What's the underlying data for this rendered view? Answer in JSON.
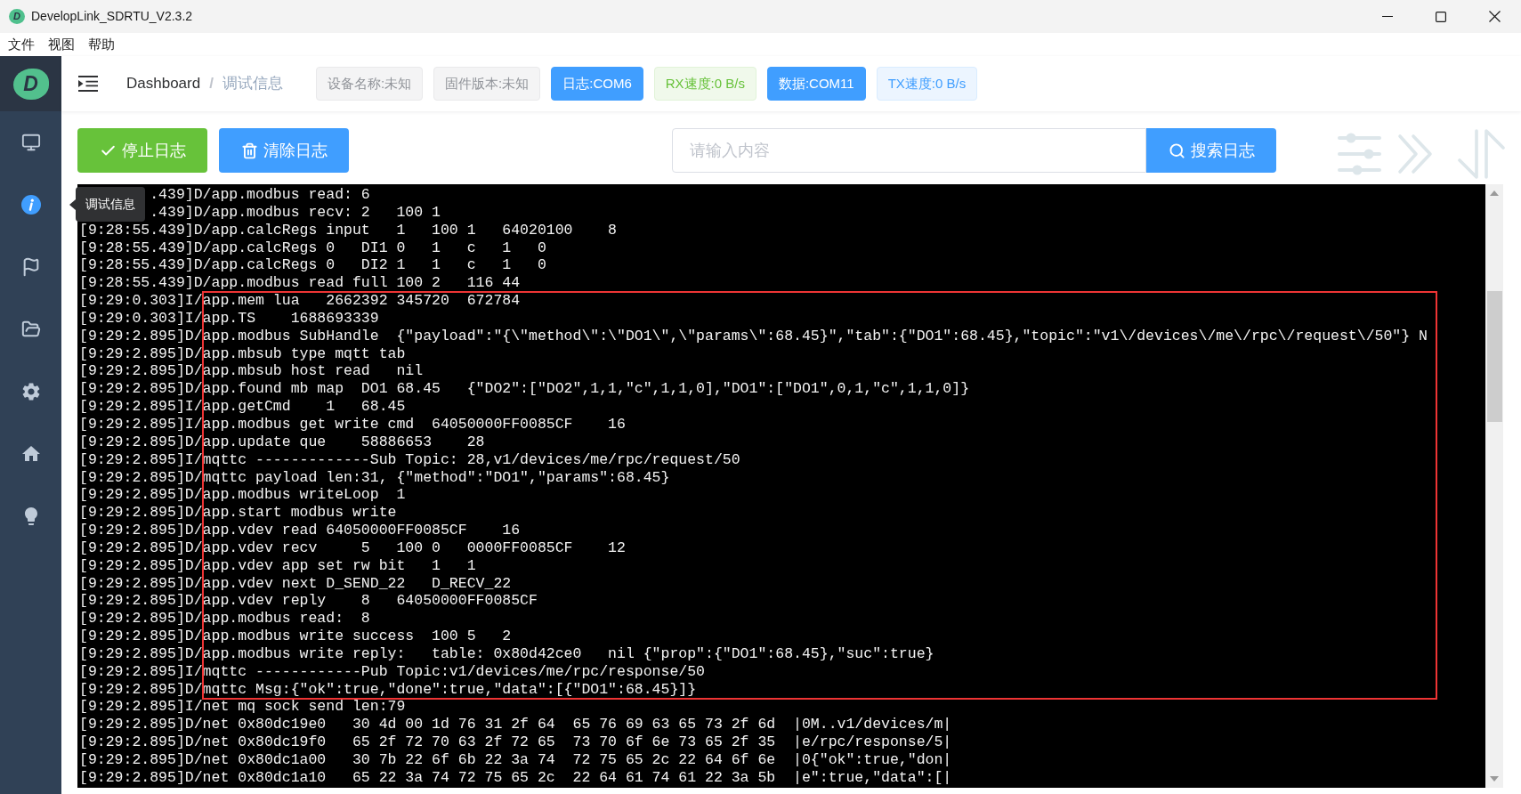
{
  "window": {
    "title": "DevelopLink_SDRTU_V2.3.2",
    "icon_letter": "D"
  },
  "menu_bar": [
    "文件",
    "视图",
    "帮助"
  ],
  "sidebar": {
    "logo_letter": "D",
    "items": [
      {
        "selected": false
      },
      {
        "selected": true
      },
      {
        "selected": false
      },
      {
        "selected": false
      },
      {
        "selected": false
      },
      {
        "selected": false
      },
      {
        "selected": false
      }
    ]
  },
  "tooltip": {
    "text": "调试信息"
  },
  "breadcrumb": {
    "separator": "/",
    "items": [
      {
        "label": "Dashboard",
        "current": false
      },
      {
        "label": "调试信息",
        "current": true
      }
    ]
  },
  "status_tags": [
    {
      "label": "设备名称:未知",
      "kind": "info"
    },
    {
      "label": "固件版本:未知",
      "kind": "info"
    },
    {
      "label": "日志:COM6",
      "kind": "dark"
    },
    {
      "label": "RX速度:0 B/s",
      "kind": "success"
    },
    {
      "label": "数据:COM11",
      "kind": "dark"
    },
    {
      "label": "TX速度:0 B/s",
      "kind": "primary"
    }
  ],
  "toolbar": {
    "buttons": [
      {
        "label": "停止日志",
        "kind": "success"
      },
      {
        "label": "清除日志",
        "kind": "primary"
      }
    ],
    "search": {
      "placeholder": "请输入内容",
      "button": "搜索日志"
    }
  },
  "log": {
    "lines": [
      {
        "text": ".439]D/app.modbus read: 6",
        "partly_hidden": true
      },
      {
        "text": ".439]D/app.modbus recv: 2   100 1",
        "partly_hidden": true
      },
      {
        "text": "[9:28:55.439]D/app.calcRegs input   1   100 1   64020100    8",
        "partly_hidden": false
      },
      {
        "text": "[9:28:55.439]D/app.calcRegs 0   DI1 0   1   c   1   0",
        "partly_hidden": false
      },
      {
        "text": "[9:28:55.439]D/app.calcRegs 0   DI2 1   1   c   1   0",
        "partly_hidden": false
      },
      {
        "text": "[9:28:55.439]D/app.modbus read full 100 2   116 44",
        "partly_hidden": false
      },
      {
        "text": "[9:29:0.303]I/app.mem lua   2662392 345720  672784",
        "partly_hidden": false
      },
      {
        "text": "[9:29:0.303]I/app.TS    1688693339",
        "partly_hidden": false
      },
      {
        "text": "[9:29:2.895]D/app.modbus SubHandle  {\"payload\":\"{\\\"method\\\":\\\"DO1\\\",\\\"params\\\":68.45}\",\"tab\":{\"DO1\":68.45},\"topic\":\"v1\\/devices\\/me\\/rpc\\/request\\/50\"} N",
        "partly_hidden": false
      },
      {
        "text": "[9:29:2.895]D/app.mbsub type mqtt tab",
        "partly_hidden": false
      },
      {
        "text": "[9:29:2.895]D/app.mbsub host read   nil",
        "partly_hidden": false
      },
      {
        "text": "[9:29:2.895]D/app.found mb map  DO1 68.45   {\"DO2\":[\"DO2\",1,1,\"c\",1,1,0],\"DO1\":[\"DO1\",0,1,\"c\",1,1,0]}",
        "partly_hidden": false
      },
      {
        "text": "[9:29:2.895]I/app.getCmd    1   68.45",
        "partly_hidden": false
      },
      {
        "text": "[9:29:2.895]I/app.modbus get write cmd  64050000FF0085CF    16",
        "partly_hidden": false
      },
      {
        "text": "[9:29:2.895]D/app.update que    58886653    28",
        "partly_hidden": false
      },
      {
        "text": "[9:29:2.895]I/mqttc -------------Sub Topic: 28,v1/devices/me/rpc/request/50",
        "partly_hidden": false
      },
      {
        "text": "[9:29:2.895]D/mqttc payload len:31, {\"method\":\"DO1\",\"params\":68.45}",
        "partly_hidden": false
      },
      {
        "text": "[9:29:2.895]D/app.modbus writeLoop  1",
        "partly_hidden": false
      },
      {
        "text": "[9:29:2.895]D/app.start modbus write",
        "partly_hidden": false
      },
      {
        "text": "[9:29:2.895]D/app.vdev read 64050000FF0085CF    16",
        "partly_hidden": false
      },
      {
        "text": "[9:29:2.895]D/app.vdev recv     5   100 0   0000FF0085CF    12",
        "partly_hidden": false
      },
      {
        "text": "[9:29:2.895]D/app.vdev app set rw bit   1   1",
        "partly_hidden": false
      },
      {
        "text": "[9:29:2.895]D/app.vdev next D_SEND_22   D_RECV_22",
        "partly_hidden": false
      },
      {
        "text": "[9:29:2.895]D/app.vdev reply    8   64050000FF0085CF",
        "partly_hidden": false
      },
      {
        "text": "[9:29:2.895]D/app.modbus read:  8",
        "partly_hidden": false
      },
      {
        "text": "[9:29:2.895]D/app.modbus write success  100 5   2",
        "partly_hidden": false
      },
      {
        "text": "[9:29:2.895]D/app.modbus write reply:   table: 0x80d42ce0   nil {\"prop\":{\"DO1\":68.45},\"suc\":true}",
        "partly_hidden": false
      },
      {
        "text": "[9:29:2.895]I/mqttc ------------Pub Topic:v1/devices/me/rpc/response/50",
        "partly_hidden": false
      },
      {
        "text": "[9:29:2.895]D/mqttc Msg:{\"ok\":true,\"done\":true,\"data\":[{\"DO1\":68.45}]}",
        "partly_hidden": false
      },
      {
        "text": "[9:29:2.895]I/net mq sock send len:79",
        "partly_hidden": false
      },
      {
        "text": "[9:29:2.895]D/net 0x80dc19e0   30 4d 00 1d 76 31 2f 64  65 76 69 63 65 73 2f 6d  |0M..v1/devices/m|",
        "partly_hidden": false
      },
      {
        "text": "[9:29:2.895]D/net 0x80dc19f0   65 2f 72 70 63 2f 72 65  73 70 6f 6e 73 65 2f 35  |e/rpc/response/5|",
        "partly_hidden": false
      },
      {
        "text": "[9:29:2.895]D/net 0x80dc1a00   30 7b 22 6f 6b 22 3a 74  72 75 65 2c 22 64 6f 6e  |0{\"ok\":true,\"don|",
        "partly_hidden": false
      },
      {
        "text": "[9:29:2.895]D/net 0x80dc1a10   65 22 3a 74 72 75 65 2c  22 64 61 74 61 22 3a 5b  |e\":true,\"data\":[|",
        "partly_hidden": false
      }
    ]
  }
}
